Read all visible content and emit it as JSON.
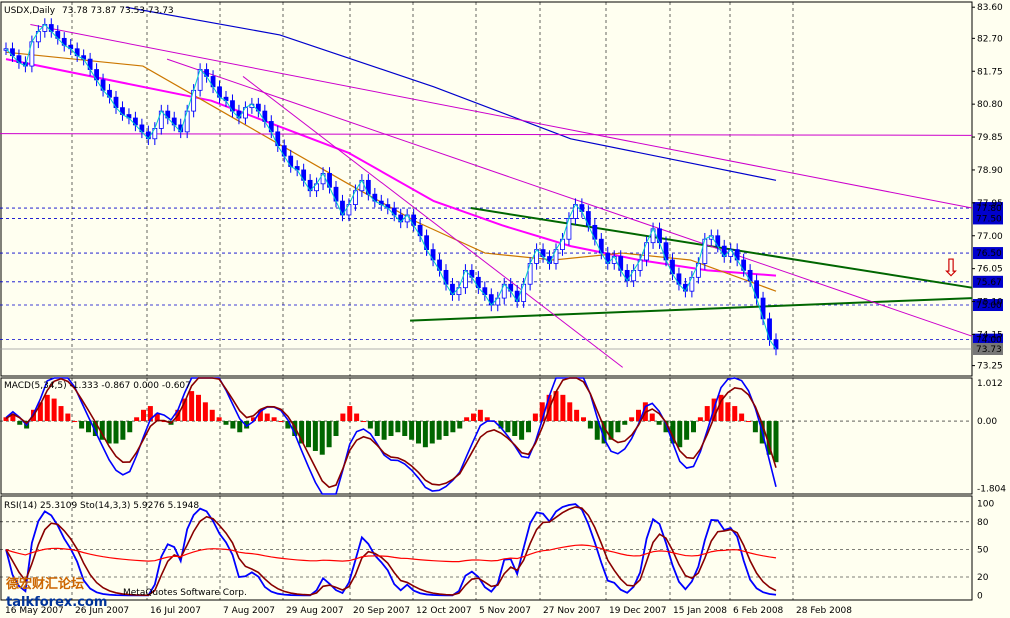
{
  "chart_data": [
    {
      "type": "candlestick",
      "header": {
        "symbol": "USDX,Daily",
        "values": "73.78 73.87 73.53 73.73"
      },
      "ylim": [
        72.95,
        83.75
      ],
      "y_ticks": [
        "83.60",
        "82.70",
        "81.75",
        "80.80",
        "79.85",
        "78.90",
        "77.95",
        "77.00",
        "76.05",
        "75.10",
        "74.15",
        "73.25"
      ],
      "price_levels": [
        {
          "label": "77.80",
          "value": 77.8,
          "box": "blue"
        },
        {
          "label": "77.50",
          "value": 77.5,
          "box": "blue"
        },
        {
          "label": "76.50",
          "value": 76.5,
          "box": "blue"
        },
        {
          "label": "75.67",
          "value": 75.67,
          "box": "blue"
        },
        {
          "label": "75.00",
          "value": 75.0,
          "box": "blue"
        },
        {
          "label": "74.00",
          "value": 74.0,
          "box": "blue"
        },
        {
          "label": "73.73",
          "value": 73.73,
          "box": "gray"
        }
      ],
      "close_series": [
        82.4,
        82.2,
        82.0,
        81.9,
        82.6,
        82.9,
        83.1,
        82.9,
        82.7,
        82.5,
        82.4,
        82.2,
        82.1,
        81.8,
        81.5,
        81.2,
        81.0,
        80.7,
        80.5,
        80.4,
        80.2,
        80.0,
        79.8,
        80.1,
        80.6,
        80.4,
        80.2,
        80.0,
        80.6,
        81.2,
        81.8,
        81.6,
        81.3,
        81.0,
        80.9,
        80.6,
        80.4,
        80.7,
        80.8,
        80.6,
        80.3,
        80.0,
        79.6,
        79.3,
        79.0,
        78.9,
        78.6,
        78.3,
        78.5,
        78.8,
        78.4,
        78.0,
        77.6,
        77.9,
        78.3,
        78.6,
        78.2,
        78.0,
        77.9,
        77.8,
        77.6,
        77.4,
        77.6,
        77.3,
        77.0,
        76.6,
        76.3,
        76.0,
        75.6,
        75.3,
        75.5,
        76.0,
        75.8,
        75.5,
        75.3,
        75.0,
        75.2,
        75.6,
        75.4,
        75.1,
        75.6,
        76.2,
        76.6,
        76.4,
        76.2,
        76.6,
        76.9,
        77.5,
        77.9,
        77.7,
        77.3,
        76.9,
        76.5,
        76.2,
        76.4,
        76.0,
        75.7,
        76.0,
        76.3,
        76.8,
        77.2,
        76.8,
        76.3,
        75.9,
        75.6,
        75.4,
        75.8,
        76.2,
        76.9,
        77.0,
        76.7,
        76.4,
        76.6,
        76.3,
        76.0,
        75.7,
        75.2,
        74.6,
        74.0,
        73.73
      ],
      "moving_averages": [
        {
          "color": "#ff00ff",
          "points": [
            [
              0,
              82.1
            ],
            [
              60,
              80.9
            ],
            [
              100,
              79.4
            ],
            [
              125,
              78.0
            ],
            [
              145,
              77.3
            ],
            [
              165,
              76.7
            ],
            [
              185,
              76.3
            ],
            [
              205,
              76.0
            ],
            [
              225,
              75.85
            ]
          ]
        },
        {
          "color": "#cc7700",
          "points": [
            [
              0,
              82.3
            ],
            [
              40,
              81.9
            ],
            [
              70,
              80.2
            ],
            [
              100,
              78.5
            ],
            [
              120,
              77.4
            ],
            [
              140,
              76.5
            ],
            [
              160,
              76.3
            ],
            [
              180,
              76.5
            ],
            [
              200,
              76.3
            ],
            [
              225,
              75.4
            ]
          ]
        },
        {
          "color": "#0000cc",
          "points": [
            [
              35,
              83.6
            ],
            [
              80,
              82.8
            ],
            [
              125,
              81.3
            ],
            [
              165,
              79.8
            ],
            [
              225,
              78.6
            ]
          ]
        }
      ],
      "trend_lines": [
        {
          "color": "#006600",
          "points": [
            [
              135,
              74.55
            ],
            [
              320,
              75.2
            ]
          ],
          "width": 2
        },
        {
          "color": "#006600",
          "points": [
            [
              155,
              77.8
            ],
            [
              320,
              75.5
            ]
          ],
          "width": 2
        },
        {
          "color": "#cc00cc",
          "points": [
            [
              0,
              79.95
            ],
            [
              320,
              79.9
            ]
          ],
          "width": 1
        },
        {
          "color": "#cc00cc",
          "points": [
            [
              10,
              83.1
            ],
            [
              320,
              77.8
            ]
          ],
          "width": 1
        },
        {
          "color": "#cc00cc",
          "points": [
            [
              55,
              82.1
            ],
            [
              320,
              74.1
            ]
          ],
          "width": 1
        },
        {
          "color": "#cc00cc",
          "points": [
            [
              80,
              81.6
            ],
            [
              205,
              73.2
            ]
          ],
          "width": 1
        }
      ],
      "arrow_label": "⇩"
    },
    {
      "type": "macd",
      "title": "MACD(5,34,5) -1.333 -0.867 0.000 -0.607",
      "ylim": [
        -1.95,
        1.15
      ],
      "y_ticks": [
        "1.012",
        "0.00",
        "-1.804"
      ],
      "histogram": [
        0.1,
        0.2,
        -0.1,
        -0.2,
        0.3,
        0.5,
        0.7,
        0.6,
        0.4,
        0.2,
        0.0,
        -0.2,
        -0.3,
        -0.4,
        -0.5,
        -0.6,
        -0.6,
        -0.5,
        -0.3,
        0.1,
        0.3,
        0.4,
        0.2,
        0.0,
        -0.1,
        0.3,
        0.6,
        0.8,
        0.7,
        0.5,
        0.3,
        0.1,
        -0.1,
        -0.2,
        -0.3,
        -0.2,
        0.1,
        0.3,
        0.2,
        0.1,
        0.0,
        -0.2,
        -0.4,
        -0.6,
        -0.7,
        -0.8,
        -0.9,
        -0.7,
        -0.4,
        0.2,
        0.4,
        0.2,
        0.0,
        -0.2,
        -0.4,
        -0.5,
        -0.4,
        -0.3,
        -0.4,
        -0.5,
        -0.6,
        -0.7,
        -0.6,
        -0.5,
        -0.4,
        -0.3,
        -0.2,
        0.1,
        0.2,
        0.3,
        0.1,
        0.0,
        -0.2,
        -0.3,
        -0.4,
        -0.5,
        -0.3,
        0.2,
        0.5,
        0.7,
        0.8,
        0.7,
        0.5,
        0.3,
        0.1,
        -0.2,
        -0.5,
        -0.6,
        -0.5,
        -0.3,
        -0.1,
        0.1,
        0.3,
        0.5,
        0.2,
        -0.1,
        -0.3,
        -0.6,
        -0.7,
        -0.5,
        -0.3,
        0.1,
        0.4,
        0.6,
        0.7,
        0.5,
        0.4,
        0.2,
        0.0,
        -0.3,
        -0.6,
        -0.9,
        -1.1
      ]
    },
    {
      "type": "oscillator",
      "title": "RSI(14) 25.3109  Sto(14,3,3) 5.9276 5.1948",
      "ylim": [
        -5,
        108
      ],
      "y_ticks": [
        "100",
        "80",
        "50",
        "20",
        "0"
      ]
    }
  ],
  "x_ticks": [
    "16 May 2007",
    "26 Jun 2007",
    "16 Jul 2007",
    "7 Aug 2007",
    "29 Aug 2007",
    "20 Sep 2007",
    "12 Oct 2007",
    "5 Nov 2007",
    "27 Nov 2007",
    "19 Dec 2007",
    "15 Jan 2008",
    "6 Feb 2008",
    "28 Feb 2008"
  ],
  "credits": {
    "vendor": "MetaQuotes Software Corp.",
    "site": "talkforex.com",
    "cjk_mark": "德宏财汇论坛"
  },
  "colors": {
    "bg": "#fffff0",
    "grid": "#000000",
    "bull": "#0000ff",
    "up_hist": "#ff0000",
    "down_hist": "#006600",
    "level_box": "#0000cc"
  }
}
